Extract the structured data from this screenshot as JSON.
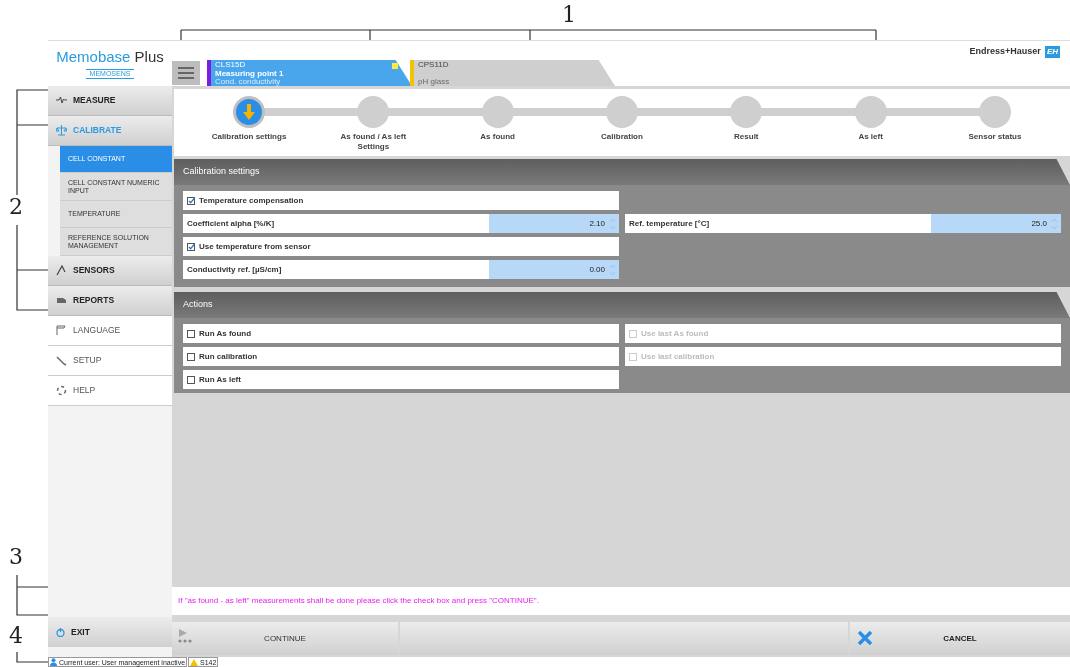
{
  "callouts": [
    {
      "label": "1"
    },
    {
      "label": "2"
    },
    {
      "label": "3"
    },
    {
      "label": "4"
    }
  ],
  "logo": {
    "title": "Memobase",
    "title_bold": "Plus",
    "subtitle": "MEMOSENS"
  },
  "brand": {
    "name": "Endress+Hauser",
    "mark": "EH"
  },
  "sensor_tabs": [
    {
      "sensor": "CLS15D",
      "name": "Measuring point 1",
      "type": "Cond. conductivity",
      "color": "#7a1fe0",
      "selected": true,
      "alert": true
    },
    {
      "sensor": "CPS11D",
      "type": "pH glass",
      "color": "#f2c200",
      "selected": false,
      "alert": false
    }
  ],
  "sidebar": {
    "items": [
      {
        "label": "MEASURE",
        "selected": false,
        "kind": "group"
      },
      {
        "label": "CALIBRATE",
        "selected": true,
        "kind": "group",
        "children": [
          {
            "label": "CELL CONSTANT",
            "selected": true
          },
          {
            "label": "CELL CONSTANT NUMERIC INPUT",
            "selected": false
          },
          {
            "label": "TEMPERATURE",
            "selected": false
          },
          {
            "label": "REFERENCE SOLUTION MANAGEMENT",
            "selected": false
          }
        ]
      },
      {
        "label": "SENSORS",
        "selected": false,
        "kind": "group"
      },
      {
        "label": "REPORTS",
        "selected": false,
        "kind": "group"
      },
      {
        "label": "LANGUAGE",
        "selected": false,
        "kind": "link"
      },
      {
        "label": "SETUP",
        "selected": false,
        "kind": "link"
      },
      {
        "label": "HELP",
        "selected": false,
        "kind": "link"
      }
    ],
    "exit": "EXIT"
  },
  "steps": [
    {
      "label": "Calibration settings",
      "selected": true
    },
    {
      "label": "As found / As left Settings",
      "selected": false
    },
    {
      "label": "As found",
      "selected": false
    },
    {
      "label": "Calibration",
      "selected": false
    },
    {
      "label": "Result",
      "selected": false
    },
    {
      "label": "As left",
      "selected": false
    },
    {
      "label": "Sensor status",
      "selected": false
    }
  ],
  "settings": {
    "title": "Calibration settings",
    "rows": [
      [
        {
          "kind": "checkbox",
          "label": "Temperature compensation",
          "checked": true
        }
      ],
      [
        {
          "kind": "number",
          "label": "Coefficient alpha [%/K]",
          "value": "2.10"
        },
        {
          "kind": "number",
          "label": "Ref. temperature [°C]",
          "value": "25.0"
        }
      ],
      [
        {
          "kind": "checkbox",
          "label": "Use temperature from sensor",
          "checked": true
        }
      ],
      [
        {
          "kind": "number",
          "label": "Conductivity ref. [µS/cm]",
          "value": "0.00"
        }
      ]
    ]
  },
  "actions": {
    "title": "Actions",
    "rows": [
      [
        {
          "kind": "checkbox",
          "label": "Run As found",
          "checked": false,
          "disabled": false
        },
        {
          "kind": "checkbox",
          "label": "Use last As found",
          "checked": false,
          "disabled": true
        }
      ],
      [
        {
          "kind": "checkbox",
          "label": "Run calibration",
          "checked": false,
          "disabled": false
        },
        {
          "kind": "checkbox",
          "label": "Use last calibration",
          "checked": false,
          "disabled": true
        }
      ],
      [
        {
          "kind": "checkbox",
          "label": "Run As left",
          "checked": false,
          "disabled": false
        }
      ]
    ]
  },
  "message": "If \"as found - as left\" measurements shall be done please click the check box and press \"CONTINUE\".",
  "buttons": {
    "continue": "CONTINUE",
    "cancel": "CANCEL"
  },
  "status_bar": {
    "user": "Current user: User management inactive",
    "warning": "S142"
  }
}
